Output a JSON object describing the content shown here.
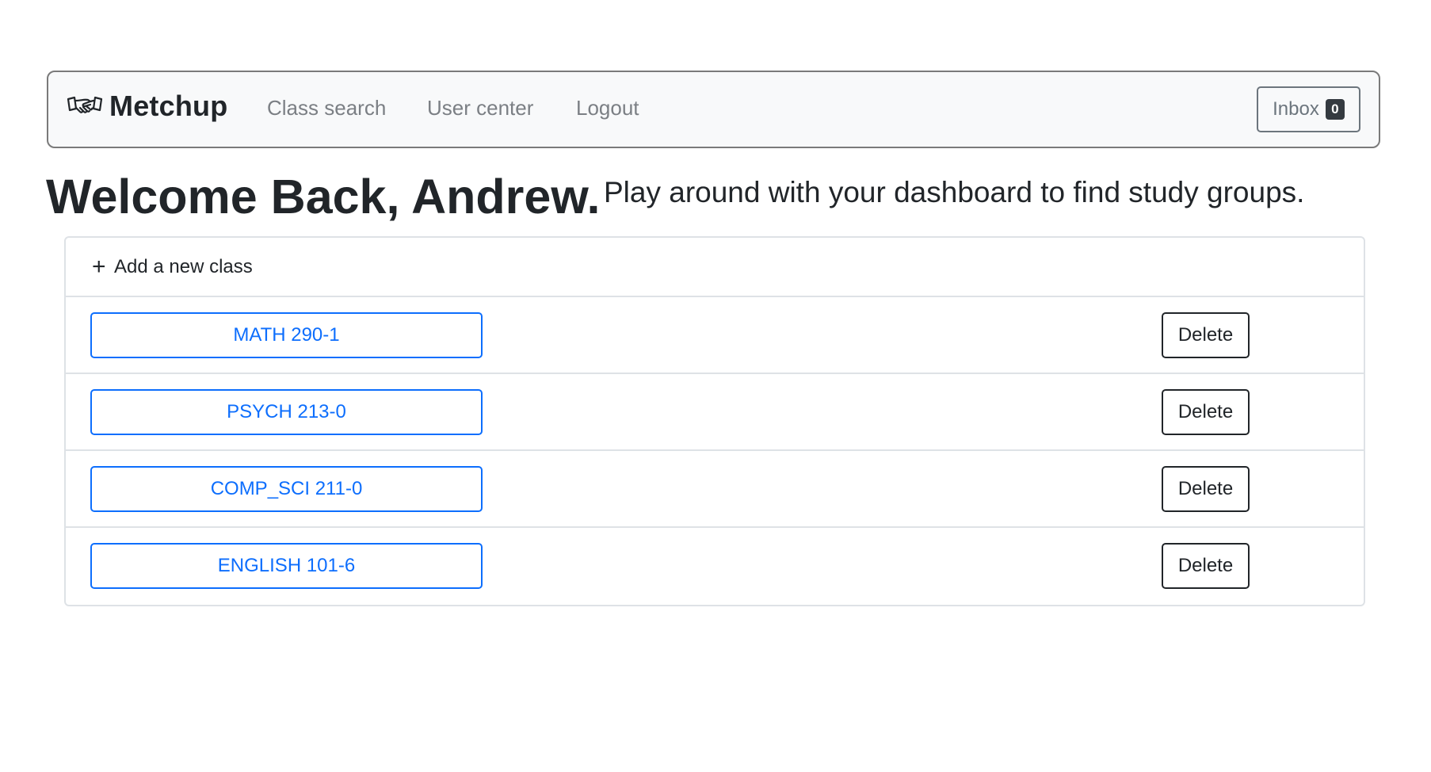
{
  "navbar": {
    "brand_icon": "handshake-icon",
    "brand_name": "Metchup",
    "links": [
      {
        "label": "Class search"
      },
      {
        "label": "User center"
      },
      {
        "label": "Logout"
      }
    ],
    "inbox": {
      "label": "Inbox",
      "count": "0"
    }
  },
  "welcome": {
    "title": "Welcome Back, Andrew.",
    "subtitle": "Play around with your dashboard to find study groups."
  },
  "class_list": {
    "add_label": "Add a new class",
    "add_icon": "plus-icon",
    "classes": [
      {
        "name": "MATH 290-1",
        "delete_label": "Delete"
      },
      {
        "name": "PSYCH 213-0",
        "delete_label": "Delete"
      },
      {
        "name": "COMP_SCI 211-0",
        "delete_label": "Delete"
      },
      {
        "name": "ENGLISH 101-6",
        "delete_label": "Delete"
      }
    ]
  },
  "colors": {
    "primary": "#0d6efd",
    "dark": "#212529",
    "muted": "#7b7f84",
    "navbar_bg": "#f8f9fa",
    "badge_bg": "#343a40",
    "border": "#dee2e6"
  }
}
